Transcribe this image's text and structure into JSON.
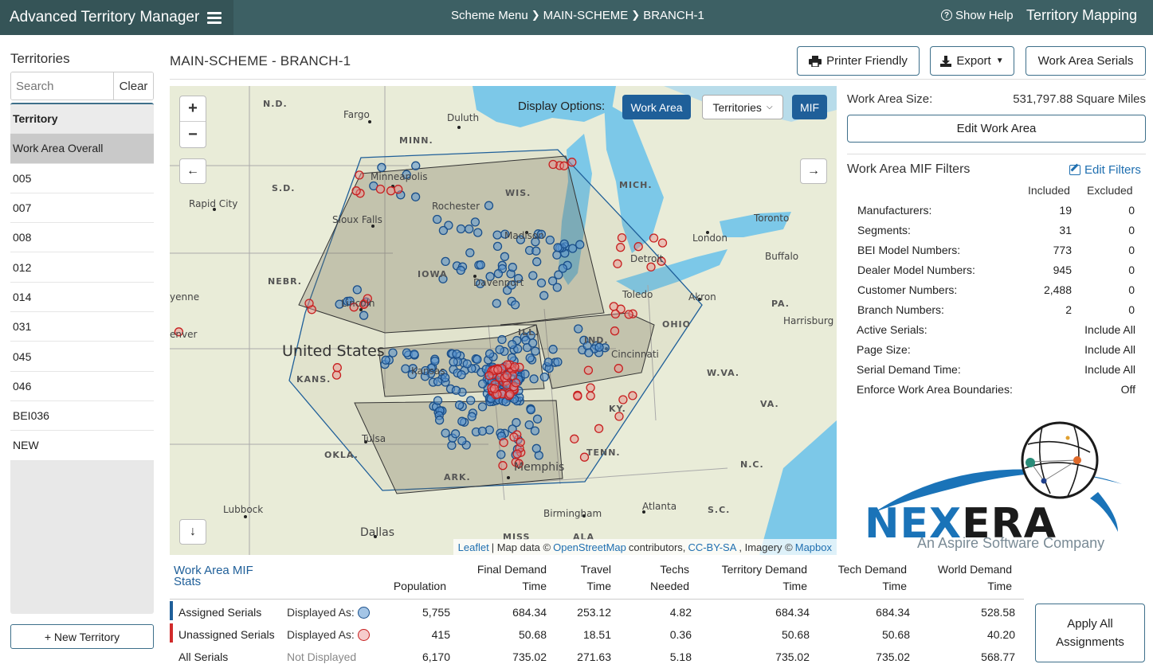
{
  "app": {
    "brand": "Advanced Territory Manager",
    "breadcrumbs": [
      "Scheme Menu",
      "MAIN-SCHEME",
      "BRANCH-1"
    ],
    "help": "Show Help",
    "title": "Territory Mapping"
  },
  "sidebar": {
    "title": "Territories",
    "search_placeholder": "Search",
    "clear": "Clear",
    "header": "Territory",
    "items": [
      "Work Area Overall",
      "005",
      "007",
      "008",
      "012",
      "014",
      "031",
      "045",
      "046",
      "BEI036",
      "NEW"
    ],
    "new_button": "+ New Territory"
  },
  "main": {
    "title": "MAIN-SCHEME - BRANCH-1",
    "printer": "Printer Friendly",
    "export": "Export",
    "serials": "Work Area Serials"
  },
  "map": {
    "display_options": "Display Options:",
    "work_area": "Work Area",
    "territories": "Territories",
    "mif": "MIF",
    "zoom_in": "+",
    "zoom_out": "−",
    "labels": {
      "nd": "N.D.",
      "fargo": "Fargo",
      "duluth": "Duluth",
      "minn": "MINN.",
      "mich": "MICH.",
      "minneapolis": "Minneapolis",
      "wis": "WIS.",
      "rochester": "Rochester",
      "sd": "S.D.",
      "rapid_city": "Rapid City",
      "sioux_falls": "Sioux Falls",
      "madison": "Madison",
      "toronto": "Toronto",
      "london": "London",
      "detroit": "Detroit",
      "buffalo": "Buffalo",
      "iowa": "IOWA",
      "nebr": "NEBR.",
      "davenport": "Davenport",
      "toledo": "Toledo",
      "lincoln": "Lincoln",
      "akron": "Akron",
      "pa": "PA.",
      "harrisburg": "Harrisburg",
      "enver": "enver",
      "ill": "ILL.",
      "ind": "IND.",
      "ohio": "OHIO",
      "united_states": "United States",
      "cincinnati": "Cincinnati",
      "kans": "KANS.",
      "kansas": "Kansas",
      "wva": "W.VA.",
      "ky": "KY.",
      "va": "VA.",
      "tulsa": "Tulsa",
      "okla": "OKLA.",
      "tenn": "TENN.",
      "nc": "N.C.",
      "ark": "ARK.",
      "memphis": "Memphis",
      "lubbock": "Lubbock",
      "atlanta": "Atlanta",
      "sc": "S.C.",
      "birmingham": "Birmingham",
      "dallas": "Dallas",
      "miss": "MISS",
      "ala": "ALA",
      "yenne": "yenne"
    },
    "attribution": {
      "leaflet": "Leaflet",
      "sep": "| Map data ©",
      "osm": "OpenStreetMap",
      "contributors": "contributors,",
      "license": "CC-BY-SA",
      "imagery": ", Imagery ©",
      "mapbox": "Mapbox"
    }
  },
  "work_area": {
    "size_label": "Work Area Size:",
    "size_value": "531,797.88 Square Miles",
    "edit_button": "Edit Work Area",
    "filters_title": "Work Area MIF Filters",
    "edit_filters": "Edit Filters",
    "included_label": "Included",
    "excluded_label": "Excluded",
    "counts": [
      {
        "label": "Manufacturers:",
        "included": "19",
        "excluded": "0"
      },
      {
        "label": "Segments:",
        "included": "31",
        "excluded": "0"
      },
      {
        "label": "BEI Model Numbers:",
        "included": "773",
        "excluded": "0"
      },
      {
        "label": "Dealer Model Numbers:",
        "included": "945",
        "excluded": "0"
      },
      {
        "label": "Customer Numbers:",
        "included": "2,488",
        "excluded": "0"
      },
      {
        "label": "Branch Numbers:",
        "included": "2",
        "excluded": "0"
      }
    ],
    "settings": [
      {
        "label": "Active Serials:",
        "value": "Include All"
      },
      {
        "label": "Page Size:",
        "value": "Include All"
      },
      {
        "label": "Serial Demand Time:",
        "value": "Include All"
      },
      {
        "label": "Enforce Work Area Boundaries:",
        "value": "Off"
      }
    ]
  },
  "logo": {
    "nex": "NEX",
    "era": "ERA",
    "tagline": "An Aspire Software Company",
    "colors": {
      "blue": "#1a73b8",
      "dark": "#1b1b1b"
    }
  },
  "stats": {
    "title": "Work Area MIF Stats",
    "columns": [
      {
        "l1": "",
        "l2": "Population"
      },
      {
        "l1": "Final Demand",
        "l2": "Time"
      },
      {
        "l1": "Travel",
        "l2": "Time"
      },
      {
        "l1": "Techs",
        "l2": "Needed"
      },
      {
        "l1": "Territory Demand",
        "l2": "Time"
      },
      {
        "l1": "Tech Demand",
        "l2": "Time"
      },
      {
        "l1": "World Demand",
        "l2": "Time"
      }
    ],
    "displayed_as": "Displayed As:",
    "rows": [
      {
        "label": "Assigned Serials",
        "display": "Displayed As:",
        "values": [
          "5,755",
          "684.34",
          "253.12",
          "4.82",
          "684.34",
          "684.34",
          "528.58"
        ]
      },
      {
        "label": "Unassigned Serials",
        "display": "Displayed As:",
        "values": [
          "415",
          "50.68",
          "18.51",
          "0.36",
          "50.68",
          "50.68",
          "40.20"
        ]
      },
      {
        "label": "All Serials",
        "display": "Not Displayed",
        "values": [
          "6,170",
          "735.02",
          "271.63",
          "5.18",
          "735.02",
          "735.02",
          "568.77"
        ]
      }
    ],
    "apply_line1": "Apply All",
    "apply_line2": "Assignments"
  },
  "colors": {
    "topbar": "#3d6064",
    "accent": "#1f5f99",
    "assigned": "#1f5f99",
    "unassigned": "#d12b2b"
  }
}
